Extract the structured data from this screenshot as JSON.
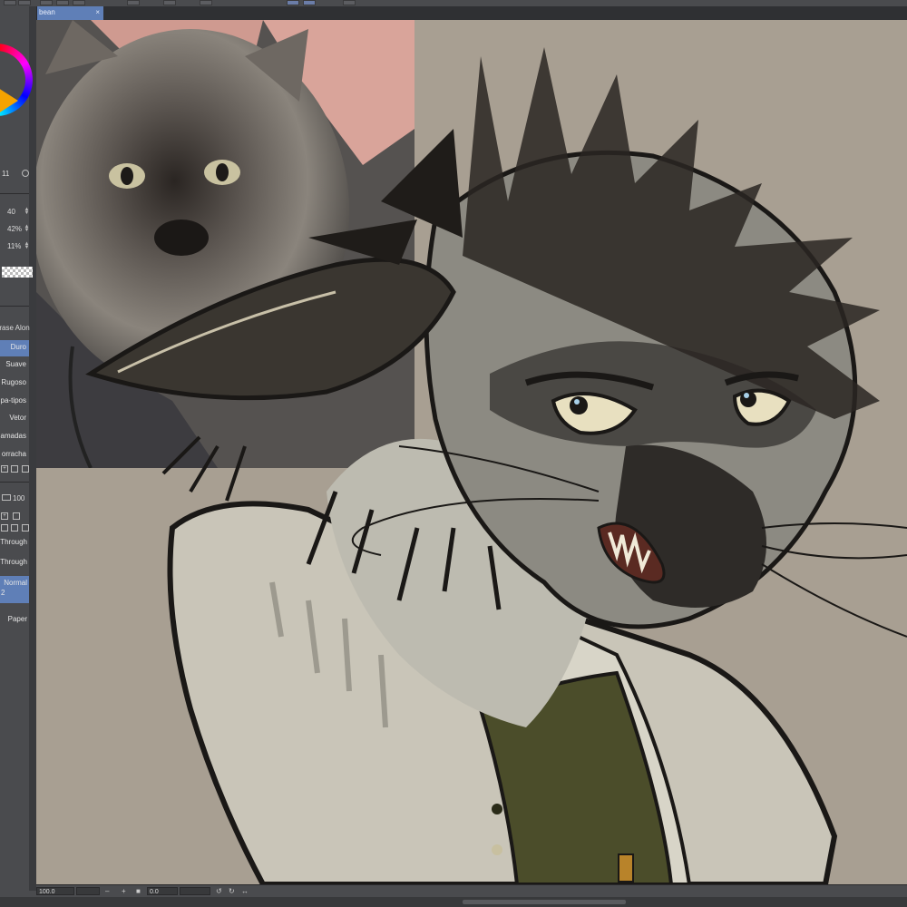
{
  "document": {
    "tab_title": "bean",
    "tab_close": "×"
  },
  "tool_properties": {
    "brush_size": "40",
    "opacity": "42%",
    "density": "11%",
    "color_indicator_value": "11"
  },
  "brush_list": {
    "header_label": "Erase Alon",
    "items": [
      {
        "label": "Duro",
        "selected": true
      },
      {
        "label": "Suave",
        "selected": false
      },
      {
        "label": "Rugoso",
        "selected": false
      },
      {
        "label": "pa-tipos",
        "selected": false
      },
      {
        "label": "Vetor",
        "selected": false
      },
      {
        "label": "amadas",
        "selected": false
      },
      {
        "label": "orracha",
        "selected": false
      }
    ]
  },
  "layer_panel": {
    "opacity_value": "100",
    "layers": [
      {
        "label": "Through",
        "selected": false
      },
      {
        "label": "Through",
        "selected": false
      },
      {
        "label": "Normal",
        "sublabel": "2",
        "selected": true
      },
      {
        "label": "Paper",
        "selected": false
      }
    ]
  },
  "status_bar": {
    "zoom": "100.0",
    "rotation": "0.0"
  },
  "colors": {
    "canvas_bg": "#a89f92",
    "accent_blue": "#5f7fb7",
    "panel_bg": "#4a4b4e",
    "main_color": "#f4a300"
  },
  "icons": [
    "color-wheel-icon",
    "spinner-icon",
    "new-layer-icon",
    "delete-icon",
    "rotate-left-icon",
    "rotate-right-icon",
    "zoom-in-icon",
    "zoom-out-icon"
  ]
}
